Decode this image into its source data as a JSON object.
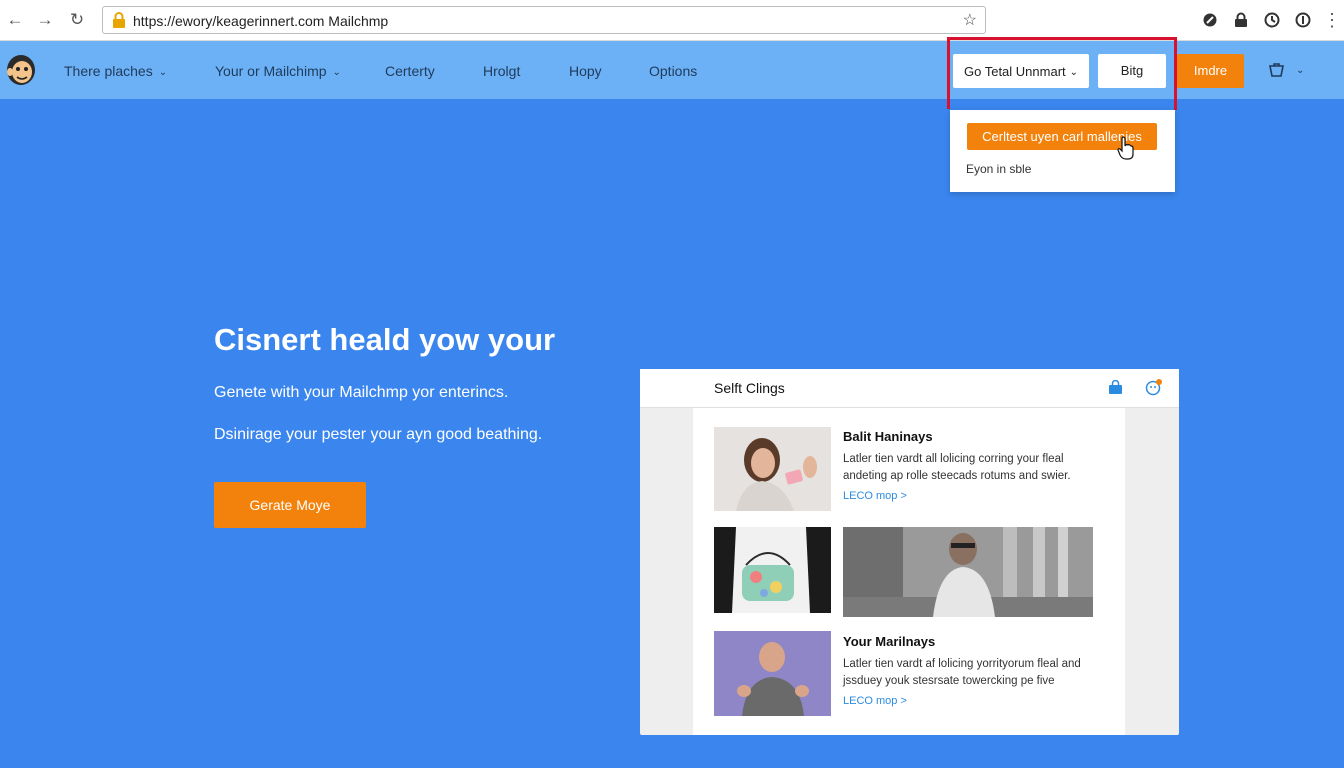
{
  "browser": {
    "url": "https://ewory/keagerinnert.com Mailchmp",
    "back_icon": "arrow-left-icon",
    "forward_icon": "arrow-right-icon",
    "reload_icon": "reload-icon"
  },
  "header": {
    "nav": [
      {
        "label": "There plaches",
        "has_caret": true
      },
      {
        "label": "Your or Mailchimp",
        "has_caret": true
      },
      {
        "label": "Certerty",
        "has_caret": false
      },
      {
        "label": "Hrolgt",
        "has_caret": false
      },
      {
        "label": "Hopy",
        "has_caret": false
      },
      {
        "label": "Options",
        "has_caret": false
      }
    ],
    "select_label": "Go Tetal Unnmart",
    "white_button": "Bitg",
    "orange_button": "Imdre"
  },
  "dropdown": {
    "button_label": "Cerltest uyen carl mallenies",
    "item_label": "Eyon in sble"
  },
  "hero": {
    "title": "Cisnert heald yow your",
    "subtitle1": "Genete with your Mailchmp yor enterincs.",
    "subtitle2": "Dsinirage your pester your ayn good beathing.",
    "cta": "Gerate Moye"
  },
  "panel": {
    "title": "Selft Clings",
    "articles": [
      {
        "title": "Balit Haninays",
        "desc": "Latler tien vardt all lolicing corring your fleal andeting ap rolle steecads rotums and swier.",
        "link": "LECO mop >"
      },
      {
        "title": "Your Marilnays",
        "desc": "Latler tien vardt af lolicing yorrityorum fleal and jssduey youk stesrsate towercking pe five",
        "link": "LECO mop >"
      }
    ]
  },
  "colors": {
    "accent_orange": "#f3820c",
    "hero_blue": "#3a86ee",
    "header_blue": "#6cb1f6",
    "highlight_red": "#d8112f"
  }
}
